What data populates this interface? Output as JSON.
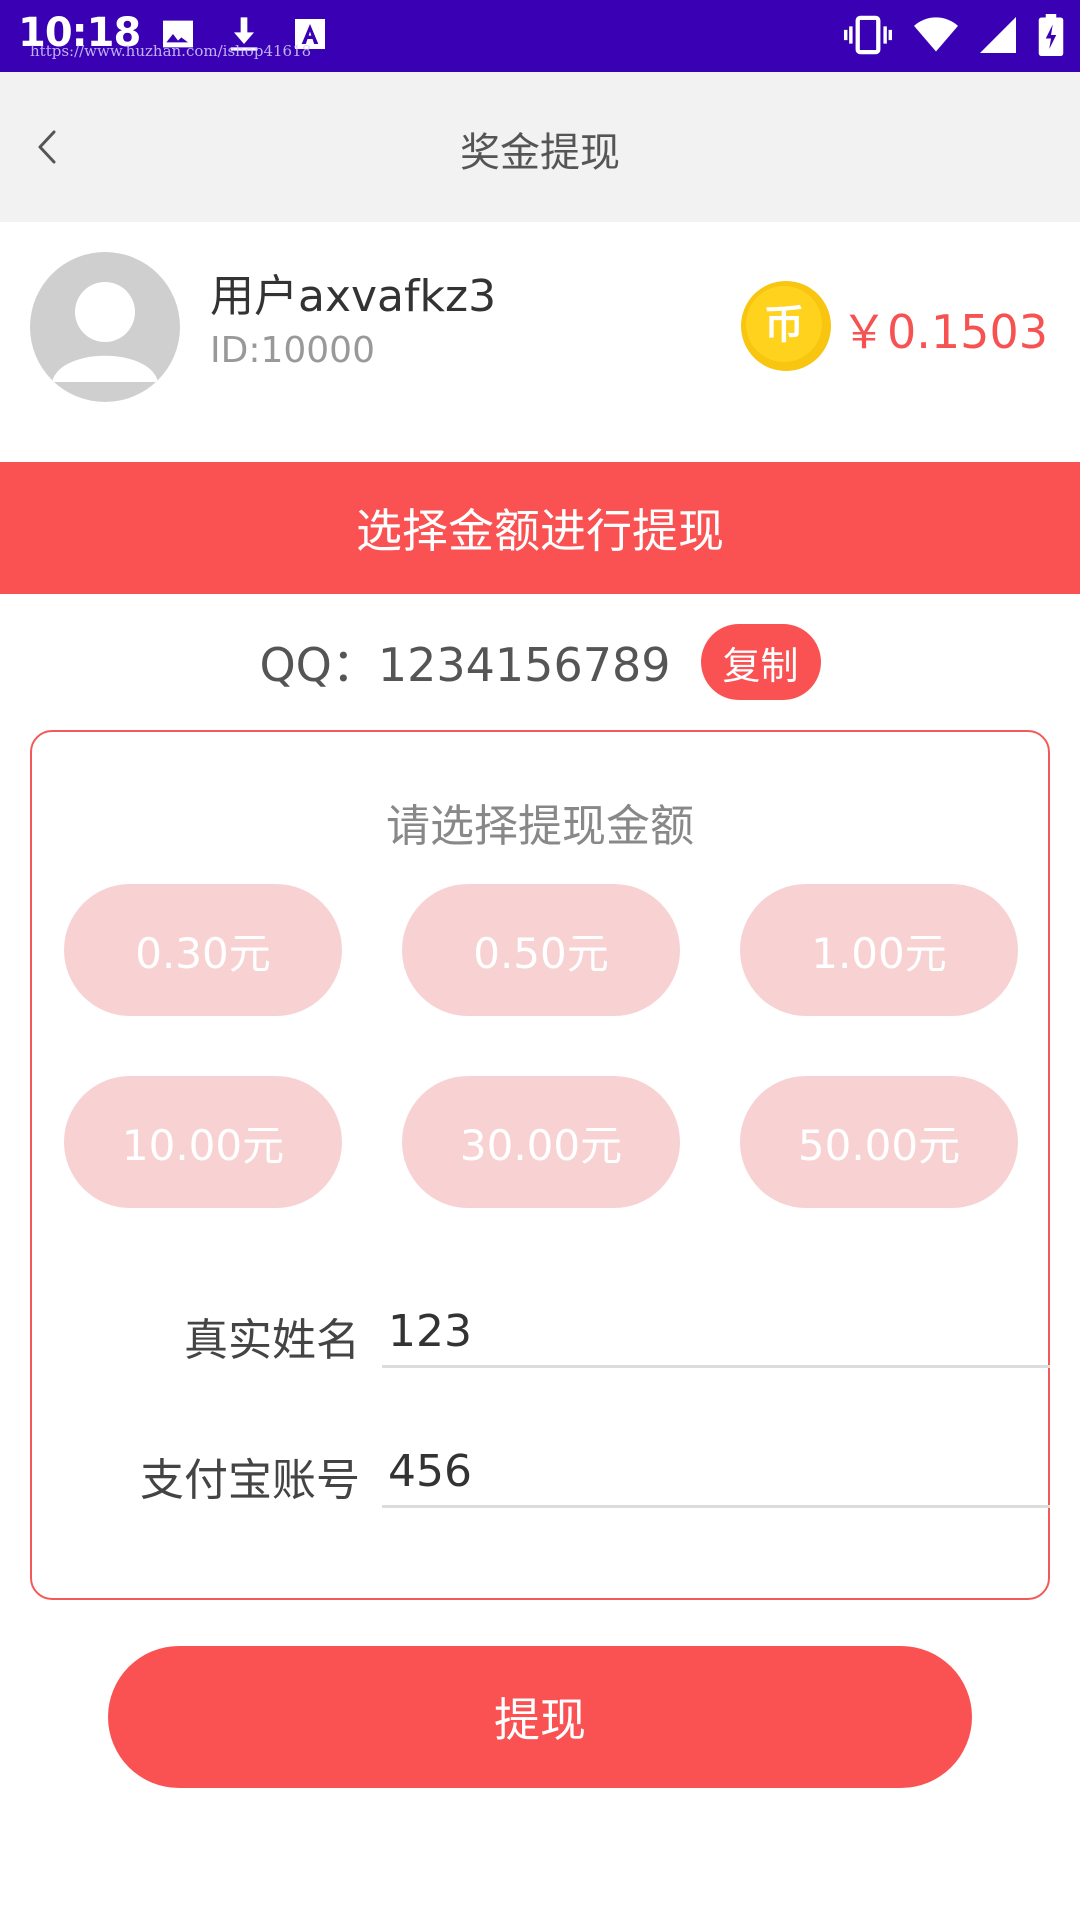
{
  "status_bar": {
    "time": "10:18",
    "watermark": "https://www.huzhan.com/ishop41618"
  },
  "nav": {
    "title": "奖金提现"
  },
  "user": {
    "name": "用户axvafkz3",
    "id": "ID:10000",
    "coin_symbol": "币",
    "balance": "￥0.1503"
  },
  "banner": {
    "text": "选择金额进行提现"
  },
  "qq": {
    "text": "QQ：1234156789",
    "copy_label": "复制"
  },
  "form": {
    "title": "请选择提现金额",
    "amounts": [
      "0.30元",
      "0.50元",
      "1.00元",
      "10.00元",
      "30.00元",
      "50.00元"
    ],
    "name_label": "真实姓名",
    "name_value": "123",
    "alipay_label": "支付宝账号",
    "alipay_value": "456"
  },
  "submit": {
    "label": "提现"
  },
  "colors": {
    "accent": "#fa5252",
    "amount_bg": "#f8d2d2",
    "status_bar": "#3a00b4"
  }
}
